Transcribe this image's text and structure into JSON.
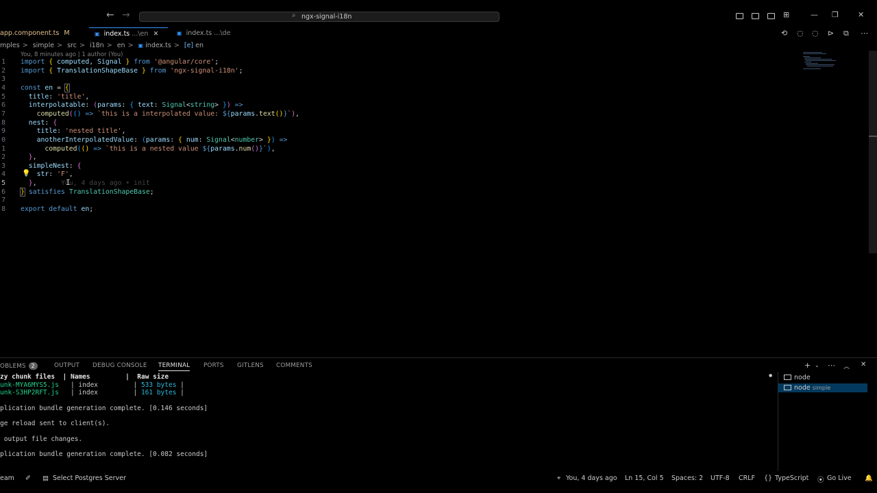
{
  "window": {
    "search_text": "ngx-signal-i18n"
  },
  "tabs": [
    {
      "label": "app.component.ts",
      "suffix": "M"
    },
    {
      "label": "index.ts",
      "suffix": "...\\en"
    },
    {
      "label": "index.ts",
      "suffix": "...\\de"
    }
  ],
  "breadcrumb": [
    "mples",
    "simple",
    "src",
    "i18n",
    "en",
    "index.ts",
    "en"
  ],
  "editor": {
    "blame_header": "You, 8 minutes ago | 1 author (You)",
    "line_numbers": [
      "1",
      "2",
      "3",
      "4",
      "5",
      "6",
      "7",
      "8",
      "9",
      "0",
      "1",
      "2",
      "3",
      "4",
      "5",
      "6",
      "7",
      "8"
    ],
    "blame_inline": "You, 4 days ago • init"
  },
  "panel": {
    "tabs": [
      "OBLEMS",
      "OUTPUT",
      "DEBUG CONSOLE",
      "TERMINAL",
      "PORTS",
      "GITLENS",
      "COMMENTS"
    ],
    "problems_count": "2",
    "terminal_header": [
      "zy chunk files",
      "|",
      "Names",
      "|",
      "Raw size"
    ],
    "terminal_rows": [
      {
        "file": "unk-MYA6MYS5.js",
        "name": "index",
        "size": "533 bytes"
      },
      {
        "file": "unk-S3HP2RFT.js",
        "name": "index",
        "size": "161 bytes"
      }
    ],
    "terminal_lines": [
      "plication bundle generation complete. [0.146 seconds]",
      "ge reload sent to client(s).",
      " output file changes.",
      "plication bundle generation complete. [0.082 seconds]"
    ],
    "sessions": [
      {
        "label": "node",
        "sub": ""
      },
      {
        "label": "node",
        "sub": "simple"
      }
    ]
  },
  "statusbar": {
    "left": [
      "eam",
      "Select Postgres Server"
    ],
    "right": [
      "You, 4 days ago",
      "Ln 15, Col 5",
      "Spaces: 2",
      "UTF-8",
      "CRLF",
      "TypeScript",
      "Go Live"
    ]
  }
}
